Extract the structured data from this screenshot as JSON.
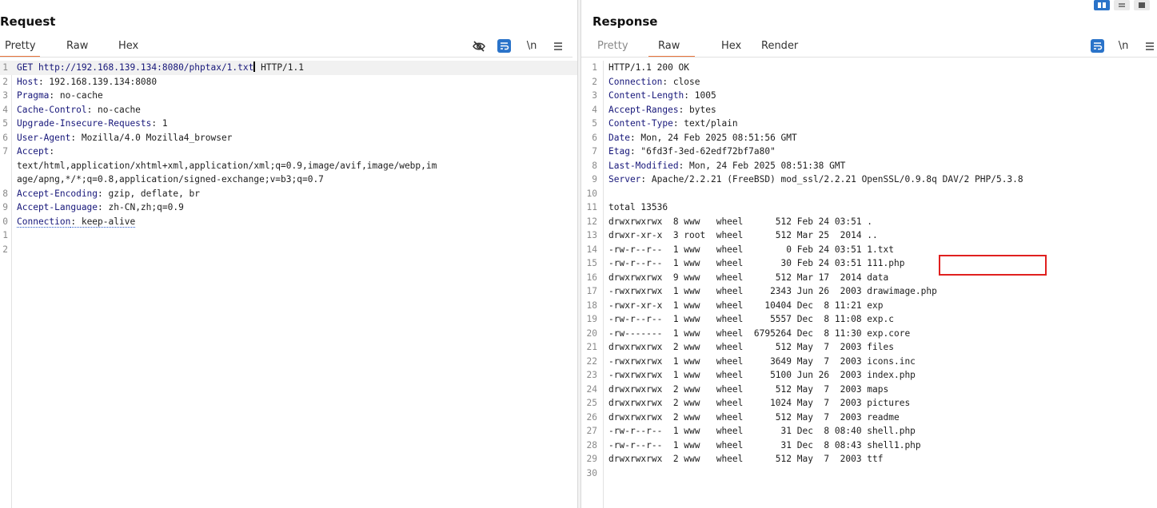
{
  "request": {
    "title": "Request",
    "tabs": [
      "Pretty",
      "Raw",
      "Hex"
    ],
    "active_tab": "Pretty",
    "tools": {
      "wrap_label": "\\n",
      "menu_icon": "hamburger-icon",
      "hide_icon": "eye-slash-icon",
      "format_icon": "wrap-lines-icon"
    },
    "lines": [
      {
        "n": "1",
        "k": "GET http://192.168.139.134:8080/phptax/1.txt",
        "v": " HTTP/1.1",
        "cursor": true
      },
      {
        "n": "2",
        "k": "Host",
        "v": ": 192.168.139.134:8080"
      },
      {
        "n": "3",
        "k": "Pragma",
        "v": ": no-cache"
      },
      {
        "n": "4",
        "k": "Cache-Control",
        "v": ": no-cache"
      },
      {
        "n": "5",
        "k": "Upgrade-Insecure-Requests",
        "v": ": 1"
      },
      {
        "n": "6",
        "k": "User-Agent",
        "v": ": Mozilla/4.0 Mozilla4_browser"
      },
      {
        "n": "7",
        "k": "Accept",
        "v": ":"
      },
      {
        "n": "",
        "k": "",
        "v": "text/html,application/xhtml+xml,application/xml;q=0.9,image/avif,image/webp,im"
      },
      {
        "n": "",
        "k": "",
        "v": "age/apng,*/*;q=0.8,application/signed-exchange;v=b3;q=0.7"
      },
      {
        "n": "8",
        "k": "Accept-Encoding",
        "v": ": gzip, deflate, br"
      },
      {
        "n": "9",
        "k": "Accept-Language",
        "v": ": zh-CN,zh;q=0.9"
      },
      {
        "n": "0",
        "k": "Connection",
        "v": ": keep-alive",
        "dotted": true
      },
      {
        "n": "1",
        "k": "",
        "v": ""
      },
      {
        "n": "2",
        "k": "",
        "v": ""
      }
    ]
  },
  "response": {
    "title": "Response",
    "tabs": [
      "Pretty",
      "Raw",
      "Hex",
      "Render"
    ],
    "active_tab": "Raw",
    "tools": {
      "wrap_label": "\\n",
      "menu_icon": "hamburger-icon",
      "format_icon": "wrap-lines-icon"
    },
    "headers": [
      {
        "n": "1",
        "k": "",
        "v": "HTTP/1.1 200 OK"
      },
      {
        "n": "2",
        "k": "Connection",
        "v": ": close"
      },
      {
        "n": "3",
        "k": "Content-Length",
        "v": ": 1005"
      },
      {
        "n": "4",
        "k": "Accept-Ranges",
        "v": ": bytes"
      },
      {
        "n": "5",
        "k": "Content-Type",
        "v": ": text/plain"
      },
      {
        "n": "6",
        "k": "Date",
        "v": ": Mon, 24 Feb 2025 08:51:56 GMT"
      },
      {
        "n": "7",
        "k": "Etag",
        "v": ": \"6fd3f-3ed-62edf72bf7a80\""
      },
      {
        "n": "8",
        "k": "Last-Modified",
        "v": ": Mon, 24 Feb 2025 08:51:38 GMT"
      },
      {
        "n": "9",
        "k": "Server",
        "v": ": Apache/2.2.21 (FreeBSD) mod_ssl/2.2.21 OpenSSL/0.9.8q DAV/2 PHP/5.3.8"
      },
      {
        "n": "10",
        "k": "",
        "v": ""
      },
      {
        "n": "11",
        "k": "",
        "v": "total 13536"
      }
    ],
    "listing": [
      {
        "n": "12",
        "t": "drwxrwxrwx  8 www   wheel      512 Feb 24 03:51 ."
      },
      {
        "n": "13",
        "t": "drwxr-xr-x  3 root  wheel      512 Mar 25  2014 .."
      },
      {
        "n": "14",
        "t": "-rw-r--r--  1 www   wheel        0 Feb 24 03:51 1.txt"
      },
      {
        "n": "15",
        "t": "-rw-r--r--  1 www   wheel       30 Feb 24 03:51 111.php"
      },
      {
        "n": "16",
        "t": "drwxrwxrwx  9 www   wheel      512 Mar 17  2014 data"
      },
      {
        "n": "17",
        "t": "-rwxrwxrwx  1 www   wheel     2343 Jun 26  2003 drawimage.php"
      },
      {
        "n": "18",
        "t": "-rwxr-xr-x  1 www   wheel    10404 Dec  8 11:21 exp"
      },
      {
        "n": "19",
        "t": "-rw-r--r--  1 www   wheel     5557 Dec  8 11:08 exp.c"
      },
      {
        "n": "20",
        "t": "-rw-------  1 www   wheel  6795264 Dec  8 11:30 exp.core"
      },
      {
        "n": "21",
        "t": "drwxrwxrwx  2 www   wheel      512 May  7  2003 files"
      },
      {
        "n": "22",
        "t": "-rwxrwxrwx  1 www   wheel     3649 May  7  2003 icons.inc"
      },
      {
        "n": "23",
        "t": "-rwxrwxrwx  1 www   wheel     5100 Jun 26  2003 index.php"
      },
      {
        "n": "24",
        "t": "drwxrwxrwx  2 www   wheel      512 May  7  2003 maps"
      },
      {
        "n": "25",
        "t": "drwxrwxrwx  2 www   wheel     1024 May  7  2003 pictures"
      },
      {
        "n": "26",
        "t": "drwxrwxrwx  2 www   wheel      512 May  7  2003 readme"
      },
      {
        "n": "27",
        "t": "-rw-r--r--  1 www   wheel       31 Dec  8 08:40 shell.php"
      },
      {
        "n": "28",
        "t": "-rw-r--r--  1 www   wheel       31 Dec  8 08:43 shell1.php"
      },
      {
        "n": "29",
        "t": "drwxrwxrwx  2 www   wheel      512 May  7  2003 ttf"
      },
      {
        "n": "30",
        "t": ""
      }
    ]
  },
  "layout_toggle": {
    "icons": [
      "split-vertical-icon",
      "split-horizontal-icon",
      "single-pane-icon"
    ],
    "active": 0
  },
  "colors": {
    "accent": "#e8743b",
    "icon_blue": "#2a73c9",
    "header_key": "#17177a",
    "highlight_box": "#e0201f"
  }
}
